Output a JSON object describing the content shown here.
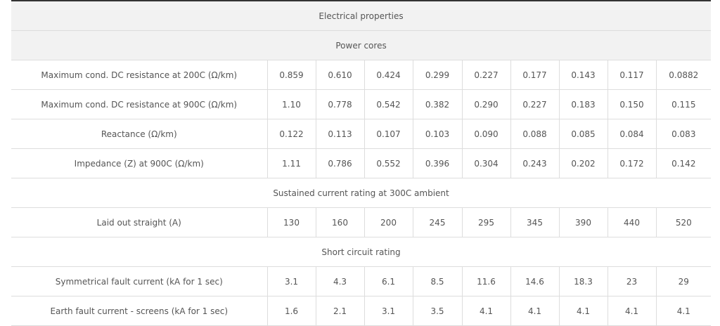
{
  "table": {
    "header": "Electrical properties",
    "section_power": "Power cores",
    "rows_power": [
      {
        "label": "Maximum cond. DC resistance at 200C (Ω/km)",
        "values": [
          "0.859",
          "0.610",
          "0.424",
          "0.299",
          "0.227",
          "0.177",
          "0.143",
          "0.117",
          "0.0882"
        ]
      },
      {
        "label": "Maximum cond. DC resistance at 900C (Ω/km)",
        "values": [
          "1.10",
          "0.778",
          "0.542",
          "0.382",
          "0.290",
          "0.227",
          "0.183",
          "0.150",
          "0.115"
        ]
      },
      {
        "label": "Reactance (Ω/km)",
        "values": [
          "0.122",
          "0.113",
          "0.107",
          "0.103",
          "0.090",
          "0.088",
          "0.085",
          "0.084",
          "0.083"
        ]
      },
      {
        "label": "Impedance (Z) at 900C (Ω/km)",
        "values": [
          "1.11",
          "0.786",
          "0.552",
          "0.396",
          "0.304",
          "0.243",
          "0.202",
          "0.172",
          "0.142"
        ]
      }
    ],
    "section_sustained": "Sustained current rating at 300C ambient",
    "rows_sustained": [
      {
        "label": "Laid out straight (A)",
        "values": [
          "130",
          "160",
          "200",
          "245",
          "295",
          "345",
          "390",
          "440",
          "520"
        ]
      }
    ],
    "section_short": "Short circuit rating",
    "rows_short": [
      {
        "label": "Symmetrical fault current (kA for 1 sec)",
        "values": [
          "3.1",
          "4.3",
          "6.1",
          "8.5",
          "11.6",
          "14.6",
          "18.3",
          "23",
          "29"
        ]
      },
      {
        "label": "Earth fault current - screens (kA for 1 sec)",
        "values": [
          "1.6",
          "2.1",
          "3.1",
          "3.5",
          "4.1",
          "4.1",
          "4.1",
          "4.1",
          "4.1"
        ]
      }
    ]
  }
}
